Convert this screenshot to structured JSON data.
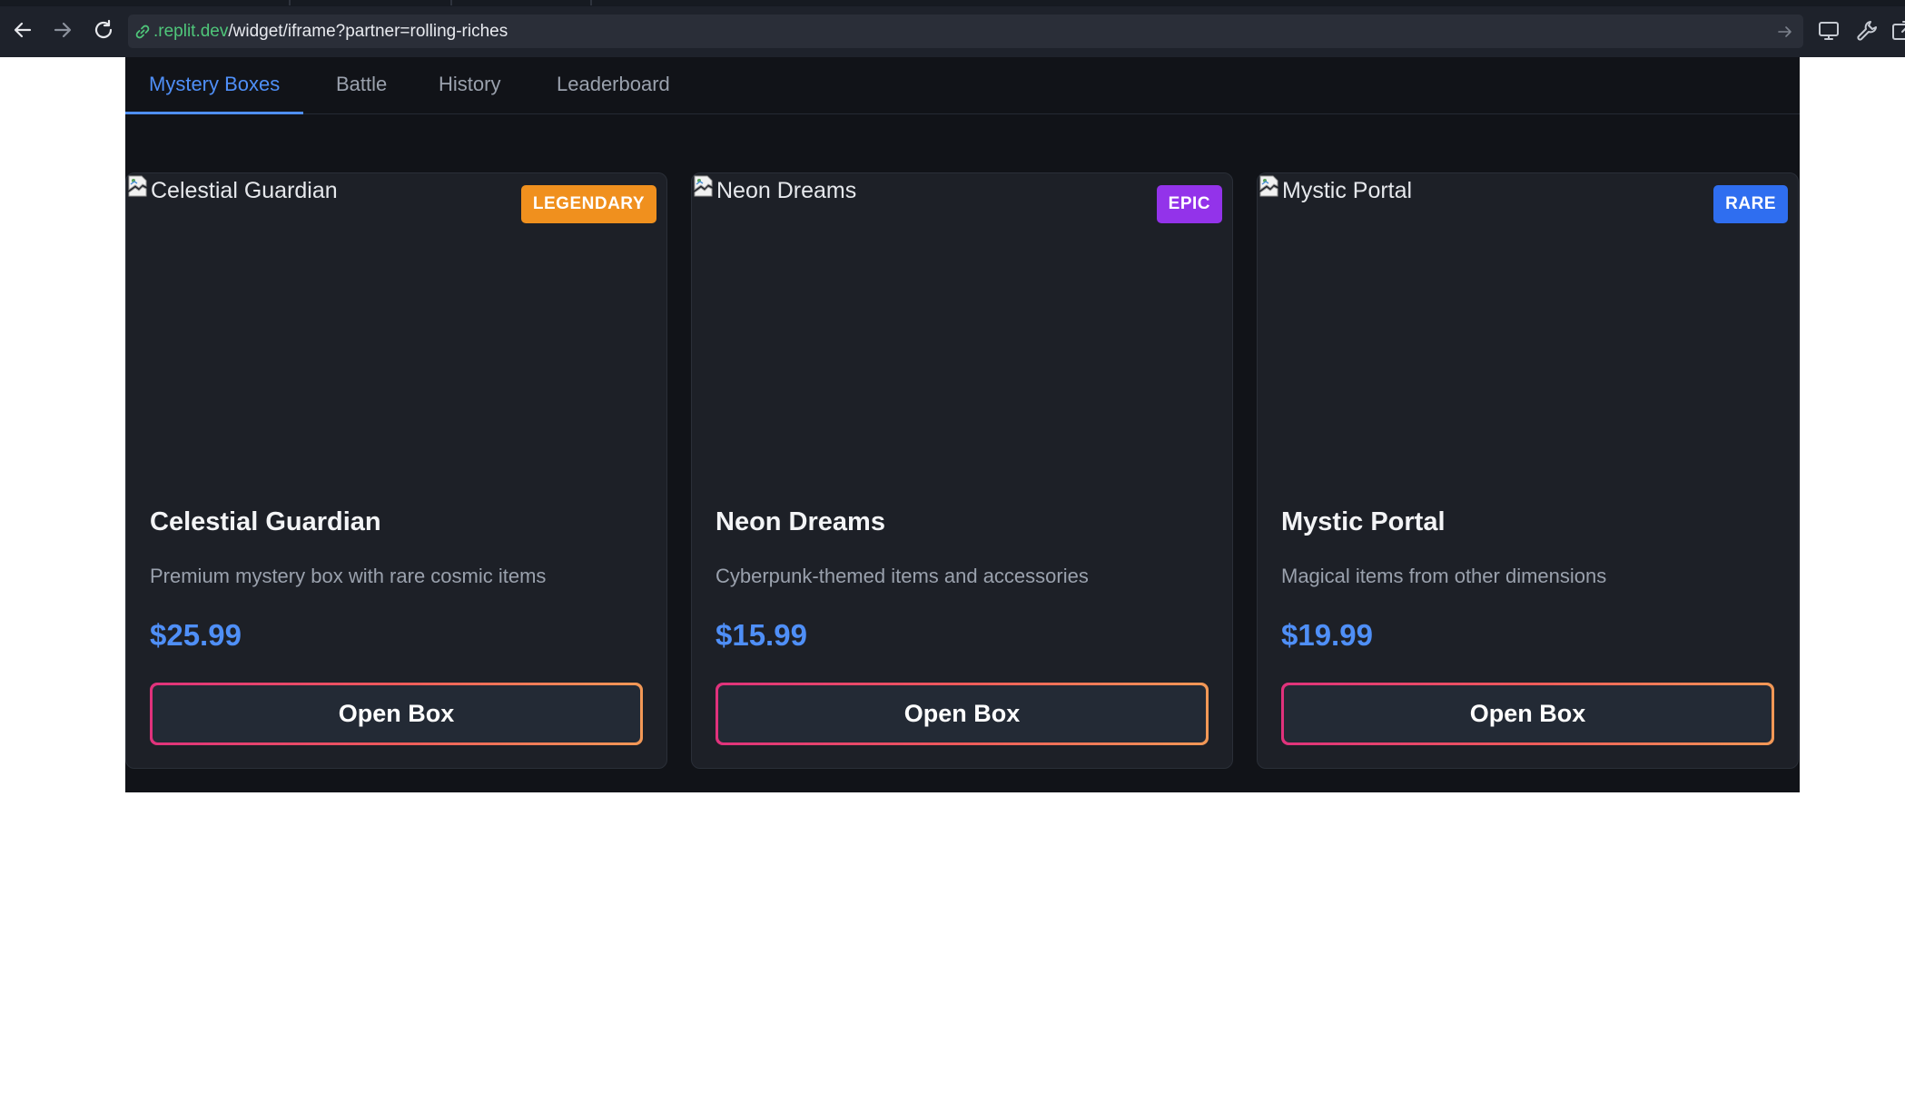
{
  "browser": {
    "url_domain": ".replit.dev",
    "url_path": "/widget/iframe?partner=rolling-riches",
    "back_icon": "arrow-left-icon",
    "forward_icon": "arrow-right-icon",
    "reload_icon": "reload-icon",
    "right_icons": [
      "monitor-icon",
      "wrench-icon",
      "external-window-icon"
    ]
  },
  "tabs": [
    {
      "label": "Mystery Boxes",
      "active": true
    },
    {
      "label": "Battle",
      "active": false
    },
    {
      "label": "History",
      "active": false
    },
    {
      "label": "Leaderboard",
      "active": false
    }
  ],
  "boxes": [
    {
      "image_alt": "Celestial Guardian",
      "rarity": "LEGENDARY",
      "rarity_color": "#f0901e",
      "name": "Celestial Guardian",
      "description": "Premium mystery box with rare cosmic items",
      "price": "$25.99",
      "button_label": "Open Box"
    },
    {
      "image_alt": "Neon Dreams",
      "rarity": "EPIC",
      "rarity_color": "#9333ea",
      "name": "Neon Dreams",
      "description": "Cyberpunk-themed items and accessories",
      "price": "$15.99",
      "button_label": "Open Box"
    },
    {
      "image_alt": "Mystic Portal",
      "rarity": "RARE",
      "rarity_color": "#2f6ef0",
      "name": "Mystic Portal",
      "description": "Magical items from other dimensions",
      "price": "$19.99",
      "button_label": "Open Box"
    }
  ],
  "colors": {
    "accent": "#4f8ff7",
    "app_background": "#111318",
    "card_background": "#1d2027",
    "button_gradient": [
      "#e0327c",
      "#f29856"
    ]
  }
}
